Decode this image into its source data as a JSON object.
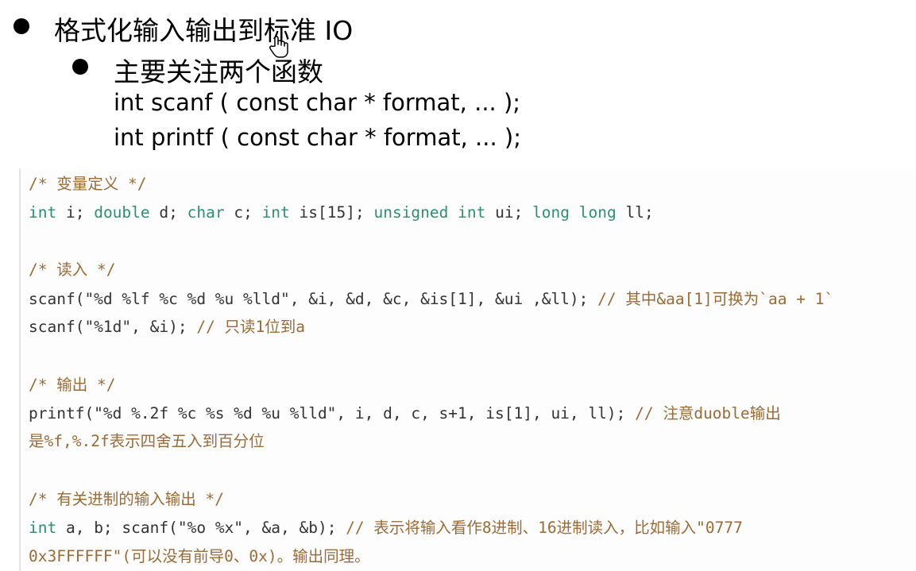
{
  "slide": {
    "bullet1": "格式化输入输出到标准 IO",
    "bullet2": "主要关注两个函数",
    "sig_scanf": "int scanf ( const char * format, ... );",
    "sig_printf": "int printf ( const char * format, ... );"
  },
  "cursor_icon": "hand-pointer-icon",
  "colors": {
    "comment": "#9a6b37",
    "keyword": "#2f8f6a",
    "text": "#333333"
  },
  "code": {
    "line1": "/* 变量定义 */",
    "line2": {
      "kw1": "int",
      "t1": " i;  ",
      "kw2": "double",
      "t2": " d;  ",
      "kw3": "char",
      "t3": " c;  ",
      "kw4": "int",
      "t4": " is[15];  ",
      "kw5": "unsigned int",
      "t5": " ui;  ",
      "kw6": "long long",
      "t6": " ll;"
    },
    "line3": "/* 读入 */",
    "line4": {
      "code": "scanf(\"%d %lf %c %d %u %lld\", &i, &d, &c, &is[1], &ui ,&ll); ",
      "comment": "// 其中&aa[1]可换为`aa + 1`"
    },
    "line5": {
      "code": "scanf(\"%1d\", &i); ",
      "comment": "// 只读1位到a"
    },
    "line6": "/* 输出 */",
    "line7": {
      "code": "printf(\"%d %.2f %c %s %d %u %lld\", i, d, c, s+1, is[1], ui, ll);  ",
      "comment": "// 注意duoble输出"
    },
    "line8": "是%f,%.2f表示四舍五入到百分位",
    "line9": "/* 有关进制的输入输出 */",
    "line10": {
      "kw": "int",
      "code": " a, b; scanf(\"%o %x\", &a, &b); ",
      "comment": "// 表示将输入看作8进制、16进制读入，比如输入\"0777"
    },
    "line11": "0x3FFFFFF\"(可以没有前导0、0x)。输出同理。"
  }
}
